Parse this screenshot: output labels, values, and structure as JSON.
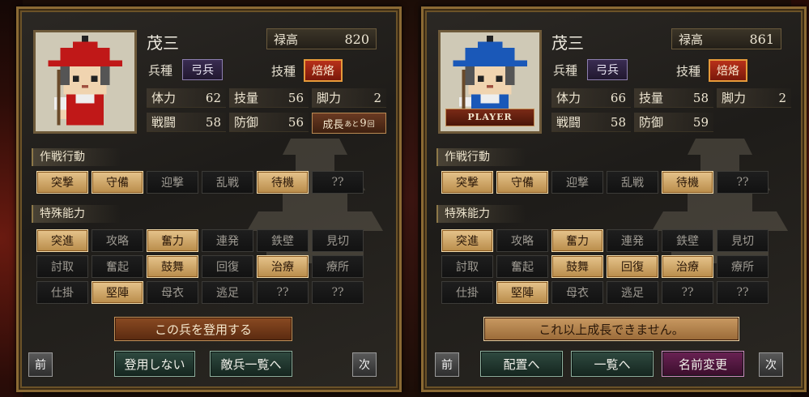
{
  "left": {
    "name": "茂三",
    "money_label": "禄高",
    "money_value": "820",
    "unit_type_label": "兵種",
    "unit_type": "弓兵",
    "skill_label": "技種",
    "skill": "焙烙",
    "stats": [
      [
        {
          "label": "体力",
          "value": "62"
        },
        {
          "label": "技量",
          "value": "56"
        },
        {
          "label": "脚力",
          "value": "2"
        }
      ],
      [
        {
          "label": "戦闘",
          "value": "58"
        },
        {
          "label": "防御",
          "value": "56"
        }
      ]
    ],
    "growth": {
      "prefix": "成長",
      "small": "あと",
      "count": "9",
      "suffix": "回"
    },
    "tactics_title": "作戦行動",
    "tactics": [
      {
        "label": "突撃",
        "on": true
      },
      {
        "label": "守備",
        "on": true
      },
      {
        "label": "迎撃",
        "on": false
      },
      {
        "label": "乱戦",
        "on": false
      },
      {
        "label": "待機",
        "on": true
      },
      {
        "label": "??",
        "on": false
      }
    ],
    "abilities_title": "特殊能力",
    "abilities": [
      {
        "label": "突進",
        "on": true
      },
      {
        "label": "攻略",
        "on": false
      },
      {
        "label": "奮力",
        "on": true
      },
      {
        "label": "連発",
        "on": false
      },
      {
        "label": "鉄壁",
        "on": false
      },
      {
        "label": "見切",
        "on": false
      },
      {
        "label": "討取",
        "on": false
      },
      {
        "label": "奮起",
        "on": false
      },
      {
        "label": "鼓舞",
        "on": true
      },
      {
        "label": "回復",
        "on": false
      },
      {
        "label": "治療",
        "on": true
      },
      {
        "label": "療所",
        "on": false
      },
      {
        "label": "仕掛",
        "on": false
      },
      {
        "label": "堅陣",
        "on": true
      },
      {
        "label": "母衣",
        "on": false
      },
      {
        "label": "逃足",
        "on": false
      },
      {
        "label": "??",
        "on": false
      },
      {
        "label": "??",
        "on": false
      }
    ],
    "recruit_button": "この兵を登用する",
    "prev": "前",
    "next": "次",
    "decline_button": "登用しない",
    "enemy_list_button": "敵兵一覧へ",
    "hat_color": "#c01818",
    "shirt_color": "#c01818"
  },
  "right": {
    "name": "茂三",
    "money_label": "禄高",
    "money_value": "861",
    "unit_type_label": "兵種",
    "unit_type": "弓兵",
    "skill_label": "技種",
    "skill": "焙烙",
    "player_tag": "PLAYER",
    "stats": [
      [
        {
          "label": "体力",
          "value": "66"
        },
        {
          "label": "技量",
          "value": "58"
        },
        {
          "label": "脚力",
          "value": "2"
        }
      ],
      [
        {
          "label": "戦闘",
          "value": "58"
        },
        {
          "label": "防御",
          "value": "59"
        }
      ]
    ],
    "tactics_title": "作戦行動",
    "tactics": [
      {
        "label": "突撃",
        "on": true
      },
      {
        "label": "守備",
        "on": true
      },
      {
        "label": "迎撃",
        "on": false
      },
      {
        "label": "乱戦",
        "on": false
      },
      {
        "label": "待機",
        "on": true
      },
      {
        "label": "??",
        "on": false
      }
    ],
    "abilities_title": "特殊能力",
    "abilities": [
      {
        "label": "突進",
        "on": true
      },
      {
        "label": "攻略",
        "on": false
      },
      {
        "label": "奮力",
        "on": true
      },
      {
        "label": "連発",
        "on": false
      },
      {
        "label": "鉄壁",
        "on": false
      },
      {
        "label": "見切",
        "on": false
      },
      {
        "label": "討取",
        "on": false
      },
      {
        "label": "奮起",
        "on": false
      },
      {
        "label": "鼓舞",
        "on": true
      },
      {
        "label": "回復",
        "on": true
      },
      {
        "label": "治療",
        "on": true
      },
      {
        "label": "療所",
        "on": false
      },
      {
        "label": "仕掛",
        "on": false
      },
      {
        "label": "堅陣",
        "on": true
      },
      {
        "label": "母衣",
        "on": false
      },
      {
        "label": "逃足",
        "on": false
      },
      {
        "label": "??",
        "on": false
      },
      {
        "label": "??",
        "on": false
      }
    ],
    "status_message": "これ以上成長できません。",
    "prev": "前",
    "next": "次",
    "deploy_button": "配置へ",
    "list_button": "一覧へ",
    "rename_button": "名前変更",
    "hat_color": "#1a58b8",
    "shirt_color": "#1a58b8"
  }
}
